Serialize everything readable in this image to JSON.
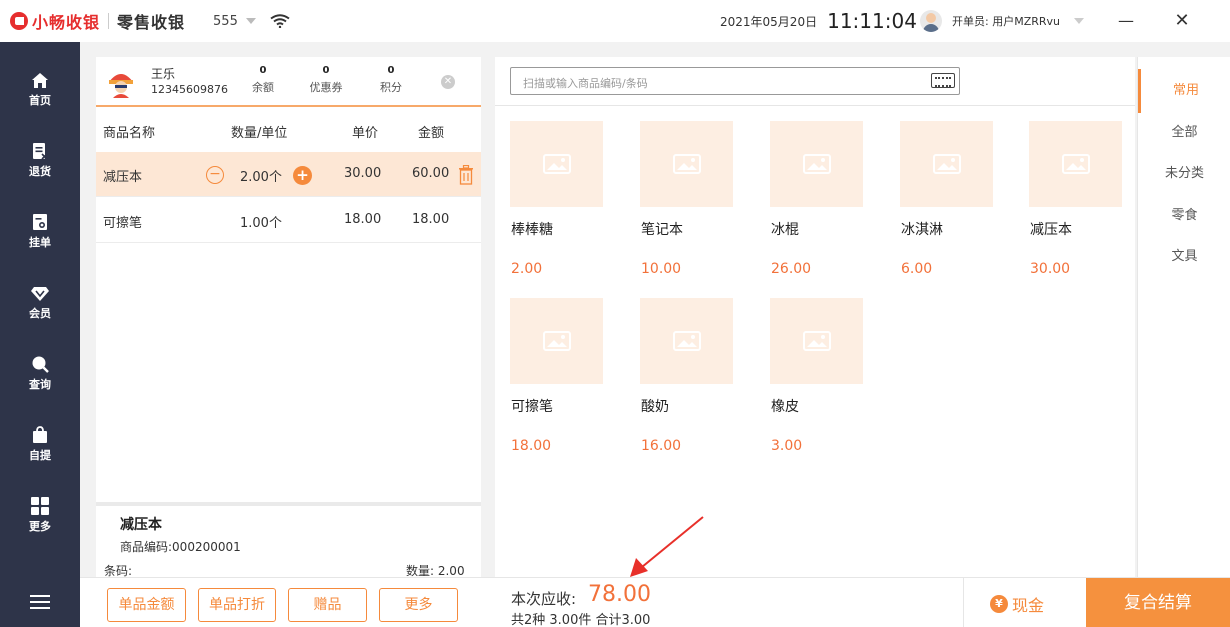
{
  "header": {
    "brand": "小畅收银",
    "app_title": "零售收银",
    "shop": "555",
    "date": "2021年05月20日",
    "time": "11:11:04",
    "cashier_label": "开单员: 用户MZRRvu",
    "minimize": "—",
    "close": "✕"
  },
  "nav": [
    {
      "label": "首页",
      "icon": "home-icon"
    },
    {
      "label": "退货",
      "icon": "return-icon"
    },
    {
      "label": "挂单",
      "icon": "hold-order-icon"
    },
    {
      "label": "会员",
      "icon": "member-icon"
    },
    {
      "label": "查询",
      "icon": "search-icon"
    },
    {
      "label": "自提",
      "icon": "pickup-icon"
    },
    {
      "label": "更多",
      "icon": "more-grid-icon"
    }
  ],
  "member": {
    "name": "王乐",
    "phone": "12345609876",
    "balance_value": "0",
    "balance_label": "余额",
    "coupon_value": "0",
    "coupon_label": "优惠券",
    "points_value": "0",
    "points_label": "积分"
  },
  "cart": {
    "headers": [
      "商品名称",
      "数量/单位",
      "单价",
      "金额"
    ],
    "rows": [
      {
        "name": "减压本",
        "qty": "2.00个",
        "price": "30.00",
        "amount": "60.00",
        "selected": true
      },
      {
        "name": "可擦笔",
        "qty": "1.00个",
        "price": "18.00",
        "amount": "18.00",
        "selected": false
      }
    ]
  },
  "detail": {
    "name": "减压本",
    "code": "商品编码:000200001",
    "barcode": "条码:",
    "qty": "数量: 2.00"
  },
  "search": {
    "placeholder": "扫描或输入商品编码/条码"
  },
  "products": [
    {
      "name": "棒棒糖",
      "price": "2.00"
    },
    {
      "name": "笔记本",
      "price": "10.00"
    },
    {
      "name": "冰棍",
      "price": "26.00"
    },
    {
      "name": "冰淇淋",
      "price": "6.00"
    },
    {
      "name": "减压本",
      "price": "30.00"
    },
    {
      "name": "可擦笔",
      "price": "18.00"
    },
    {
      "name": "酸奶",
      "price": "16.00"
    },
    {
      "name": "橡皮",
      "price": "3.00"
    }
  ],
  "categories": [
    {
      "label": "常用",
      "active": true
    },
    {
      "label": "全部",
      "active": false
    },
    {
      "label": "未分类",
      "active": false
    },
    {
      "label": "零食",
      "active": false
    },
    {
      "label": "文具",
      "active": false
    }
  ],
  "actions": {
    "item_amount": "单品金额",
    "item_discount": "单品打折",
    "gift": "赠品",
    "more": "更多"
  },
  "summary": {
    "due_label": "本次应收:",
    "due_amount": "78.00",
    "sub": "共2种 3.00件 合计3.00"
  },
  "payment": {
    "cash": "现金",
    "cash_symbol": "¥",
    "combo": "复合结算"
  },
  "colors": {
    "accent": "#f58a3c",
    "price": "#f2713a",
    "nav_bg": "#2e3449",
    "brand_red": "#e62e2e"
  }
}
